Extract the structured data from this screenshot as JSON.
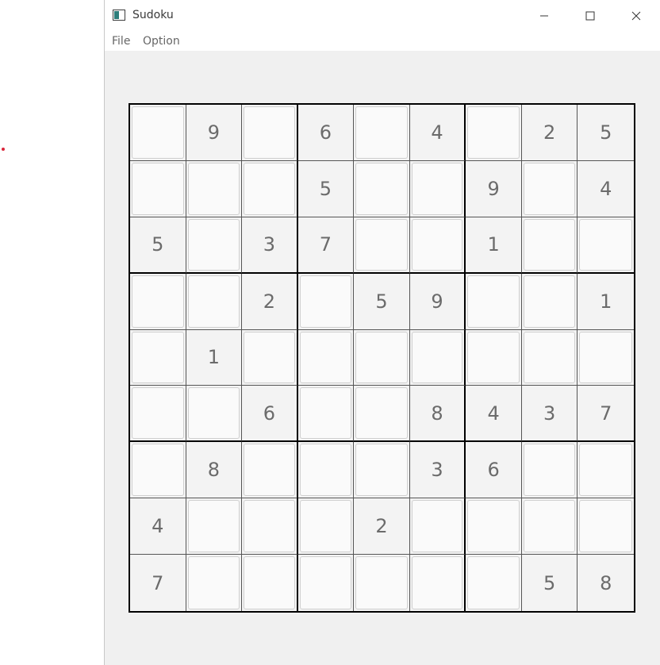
{
  "window": {
    "title": "Sudoku",
    "controls": {
      "minimize_icon": "minimize-icon",
      "maximize_icon": "maximize-icon",
      "close_icon": "close-icon"
    }
  },
  "menu": {
    "file": "File",
    "option": "Option"
  },
  "grid": [
    [
      "",
      "9",
      "",
      "6",
      "",
      "4",
      "",
      "2",
      "5"
    ],
    [
      "",
      "",
      "",
      "5",
      "",
      "",
      "9",
      "",
      "4"
    ],
    [
      "5",
      "",
      "3",
      "7",
      "",
      "",
      "1",
      "",
      ""
    ],
    [
      "",
      "",
      "2",
      "",
      "5",
      "9",
      "",
      "",
      "1"
    ],
    [
      "",
      "1",
      "",
      "",
      "",
      "",
      "",
      "",
      ""
    ],
    [
      "",
      "",
      "6",
      "",
      "",
      "8",
      "4",
      "3",
      "7"
    ],
    [
      "",
      "8",
      "",
      "",
      "",
      "3",
      "6",
      "",
      ""
    ],
    [
      "4",
      "",
      "",
      "",
      "2",
      "",
      "",
      "",
      ""
    ],
    [
      "7",
      "",
      "",
      "",
      "",
      "",
      "",
      "5",
      "8"
    ]
  ]
}
